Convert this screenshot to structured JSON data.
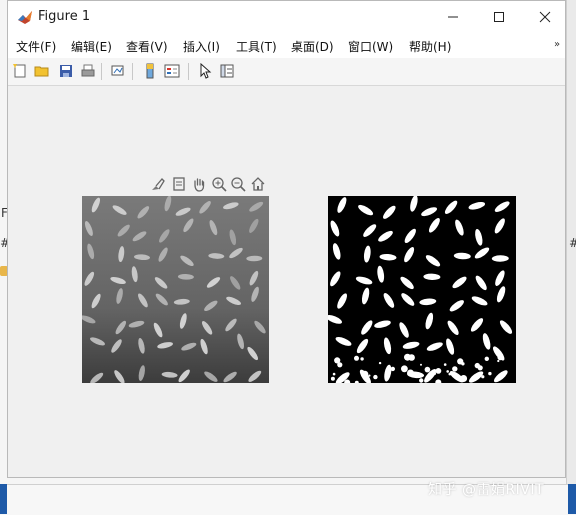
{
  "window": {
    "title": "Figure 1"
  },
  "menu": {
    "items": [
      "文件(F)",
      "编辑(E)",
      "查看(V)",
      "插入(I)",
      "工具(T)",
      "桌面(D)",
      "窗口(W)",
      "帮助(H)"
    ],
    "overflow_icon": "chevron-double-icon"
  },
  "toolbar": {
    "icons": [
      "new-figure-icon",
      "open-icon",
      "save-icon",
      "print-icon",
      "link-plot-icon",
      "colorbar-icon",
      "legend-icon",
      "pointer-icon",
      "property-editor-icon"
    ]
  },
  "axes_toolbar": {
    "icons": [
      "brush-icon",
      "data-tips-icon",
      "pan-icon",
      "zoom-in-icon",
      "zoom-out-icon",
      "home-icon"
    ]
  },
  "images": {
    "left": "grayscale-rice-image",
    "right": "binary-rice-image"
  },
  "watermark": {
    "text": "知乎 @雷娟RIVIT"
  },
  "colors": {
    "window_bg": "#f0f0f0",
    "titlebar_bg": "#ffffff",
    "toolbar_bg": "#f5f5f5"
  }
}
